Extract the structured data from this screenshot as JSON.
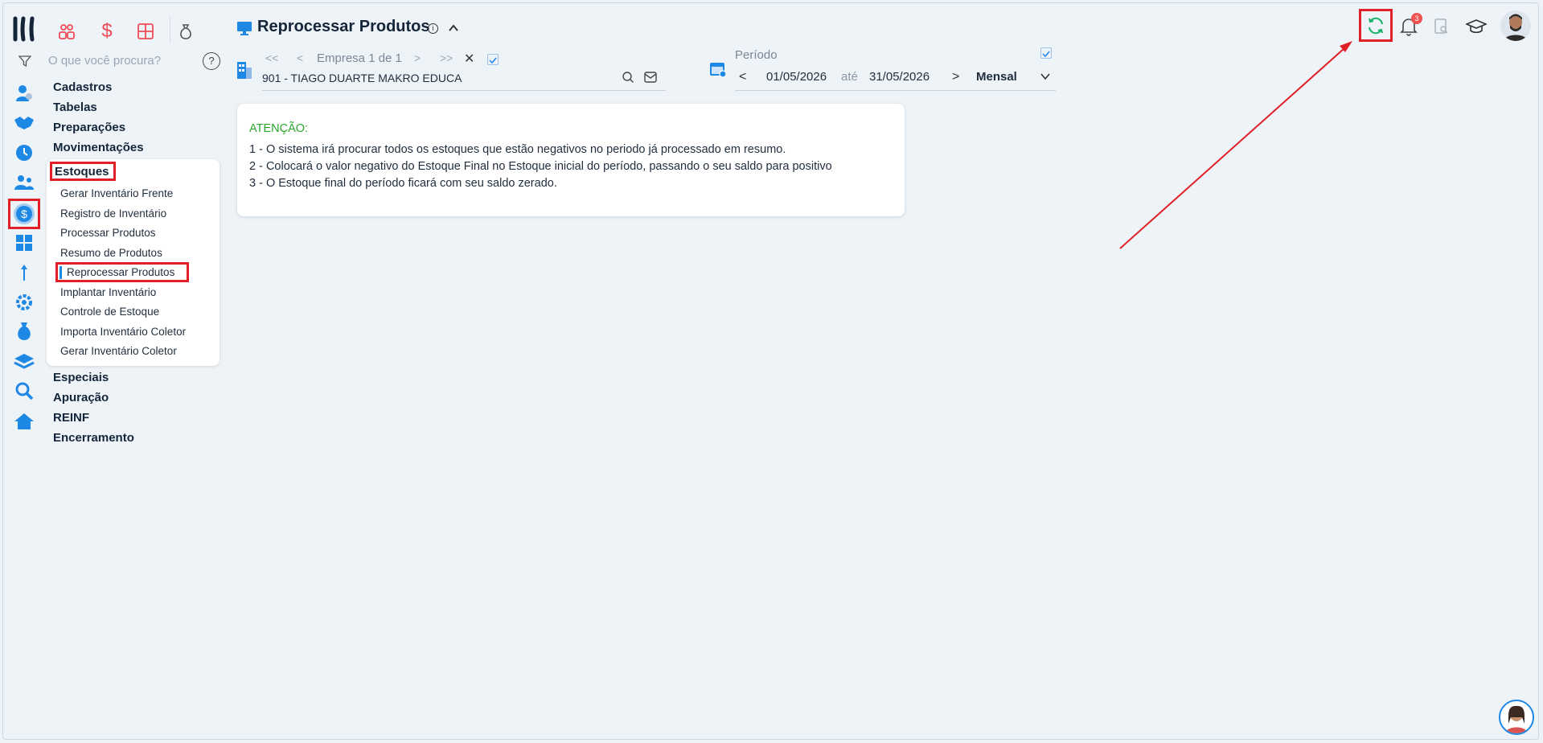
{
  "header": {
    "title": "Reprocessar Produtos"
  },
  "search": {
    "placeholder": "O que você procura?"
  },
  "menu": {
    "items": [
      "Cadastros",
      "Tabelas",
      "Preparações",
      "Movimentações"
    ],
    "estoques_label": "Estoques",
    "estoques_sub": [
      "Gerar Inventário Frente",
      "Registro de Inventário",
      "Processar Produtos",
      "Resumo de Produtos",
      "Reprocessar Produtos",
      "Implantar Inventário",
      "Controle de Estoque",
      "Importa Inventário Coletor",
      "Gerar Inventário Coletor"
    ],
    "items_after": [
      "Especiais",
      "Apuração",
      "REINF",
      "Encerramento"
    ]
  },
  "empresa": {
    "pager_label": "Empresa 1 de 1",
    "company": "901 - TIAGO DUARTE MAKRO EDUCA"
  },
  "periodo": {
    "label": "Período",
    "start": "01/05/2026",
    "sep": "até",
    "end": "31/05/2026",
    "mode": "Mensal"
  },
  "notifications": {
    "count": "3"
  },
  "notice": {
    "heading": "ATENÇÃO:",
    "lines": [
      "1 - O sistema irá procurar todos os estoques que estão negativos no periodo já processado em resumo.",
      "2 - Colocará o valor negativo do Estoque Final no Estoque inicial do período, passando o seu saldo para positivo",
      "3 - O Estoque final do período ficará com seu saldo zerado."
    ]
  },
  "colors": {
    "accent": "#1e88e5",
    "attention": "#2aa52a",
    "highlight": "#e01f26",
    "active_icon_bg": "#1e88e5",
    "refresh_icon": "#19b36b",
    "notif_badge": "#ef5350"
  }
}
